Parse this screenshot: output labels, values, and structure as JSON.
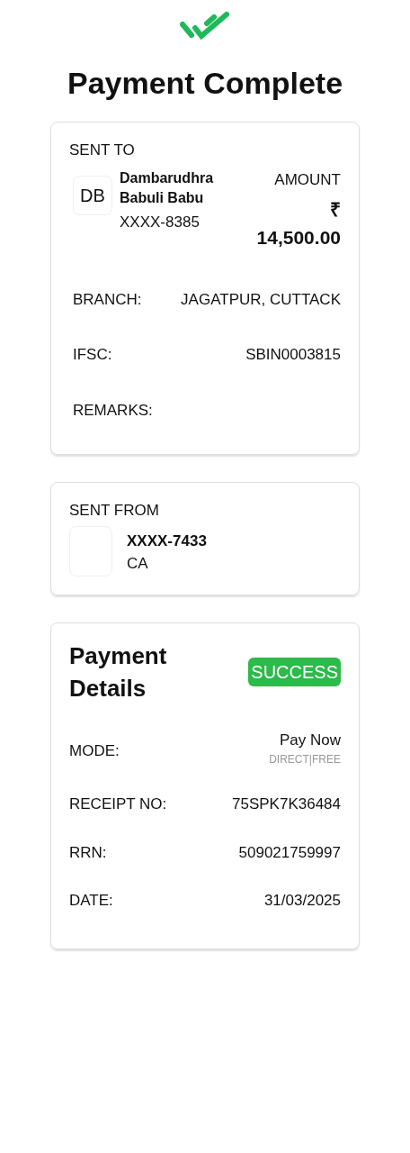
{
  "title": "Payment Complete",
  "sent_to": {
    "label": "SENT TO",
    "initials": "DB",
    "name": "Dambarudhra Babuli Babu",
    "account": "XXXX-8385",
    "amount_label": "AMOUNT",
    "currency": "₹",
    "amount": "14,500.00",
    "fields": [
      {
        "label": "BRANCH:",
        "value": "JAGATPUR, CUTTACK"
      },
      {
        "label": "IFSC:",
        "value": "SBIN0003815"
      },
      {
        "label": "REMARKS:"
      }
    ]
  },
  "sent_from": {
    "label": "SENT FROM",
    "account": "XXXX-7433",
    "type": "CA"
  },
  "payment_details": {
    "title": "Payment Details",
    "status": {
      "label": "SUCCESS",
      "kind": "success"
    },
    "fields": [
      {
        "label": "MODE:",
        "value": "Pay Now",
        "note": "DIRECT|FREE"
      },
      {
        "label": "RECEIPT NO:",
        "value": "75SPK7K36484"
      },
      {
        "label": "RRN:",
        "value": "509021759997"
      },
      {
        "label": "DATE:",
        "value": "31/03/2025"
      }
    ]
  }
}
